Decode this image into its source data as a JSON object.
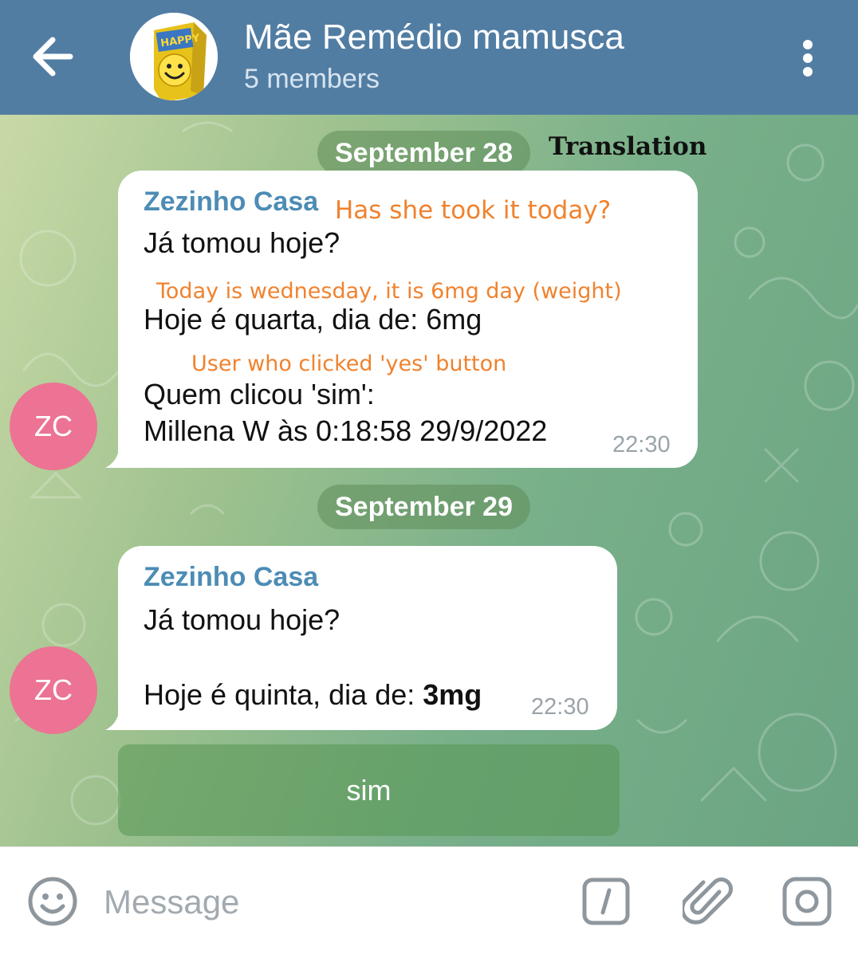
{
  "header": {
    "title": "Mãe Remédio mamusca",
    "subtitle": "5 members",
    "avatar_label": "HAPPY PILL",
    "back_icon": "arrow-left-icon",
    "menu_icon": "more-vertical-icon"
  },
  "annotation": {
    "translation_label": "Translation"
  },
  "chat": {
    "date1": "September 28",
    "date2": "September 29",
    "messages": [
      {
        "sender": "Zezinho Casa",
        "sender_initials": "ZC",
        "line1": "Já tomou hoje?",
        "line2": "Hoje é quarta, dia de: 6mg",
        "line3": "Quem clicou 'sim':",
        "line4": "Millena W às 0:18:58 29/9/2022",
        "time": "22:30",
        "note1": "Has she took it today?",
        "note2": "Today is wednesday, it is 6mg day (weight)",
        "note3": "User who clicked 'yes' button"
      },
      {
        "sender": "Zezinho Casa",
        "sender_initials": "ZC",
        "line1": "Já tomou hoje?",
        "line2_prefix": "Hoje é quinta, dia de: ",
        "line2_bold": "3mg",
        "time": "22:30"
      }
    ],
    "inline_button_label": "sim"
  },
  "input": {
    "placeholder": "Message",
    "emoji_icon": "smile-icon",
    "commands_icon": "slash-command-icon",
    "attach_icon": "paperclip-icon",
    "camera_icon": "camera-icon"
  },
  "colors": {
    "header_bg": "#527da3",
    "sender_name": "#4d8cb5",
    "avatar_bg": "#ec7393",
    "annotation_orange": "#f0822e"
  }
}
